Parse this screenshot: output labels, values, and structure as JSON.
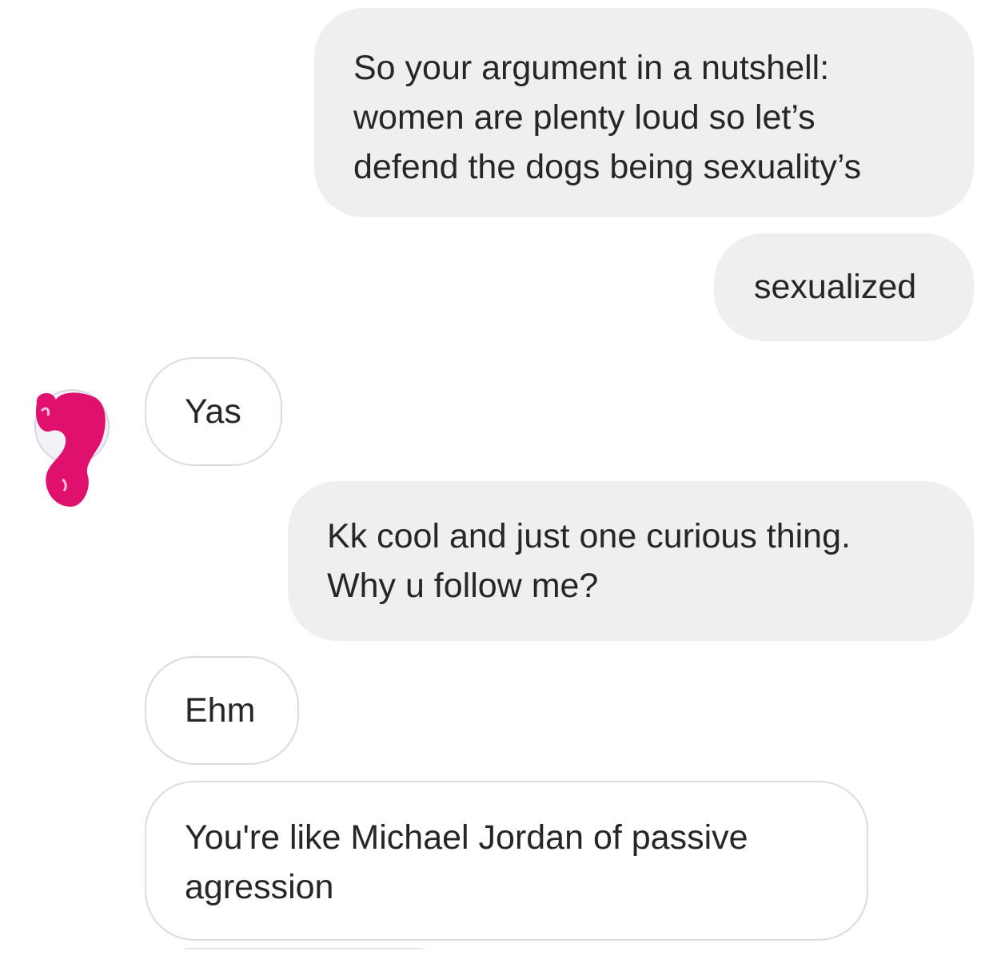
{
  "conversation": {
    "messages": [
      {
        "sender": "me",
        "text": "So your argument in a nutshell:\nwomen are plenty loud so let’s\ndefend the dogs being sexuality’s"
      },
      {
        "sender": "me",
        "text": "sexualized"
      },
      {
        "sender": "them",
        "text": "Yas"
      },
      {
        "sender": "me",
        "text": "Kk cool and just one curious thing.\nWhy u follow me?"
      },
      {
        "sender": "them",
        "text": "Ehm"
      },
      {
        "sender": "them",
        "text": "You're like Michael Jordan of passive\nagression"
      }
    ]
  },
  "colors": {
    "outgoing_bubble": "#efefef",
    "incoming_border": "#dcdcdc",
    "text": "#262626",
    "avatar_scribble": "#e0106f"
  },
  "icons": {
    "avatar": "scribbled-out-profile-picture"
  }
}
